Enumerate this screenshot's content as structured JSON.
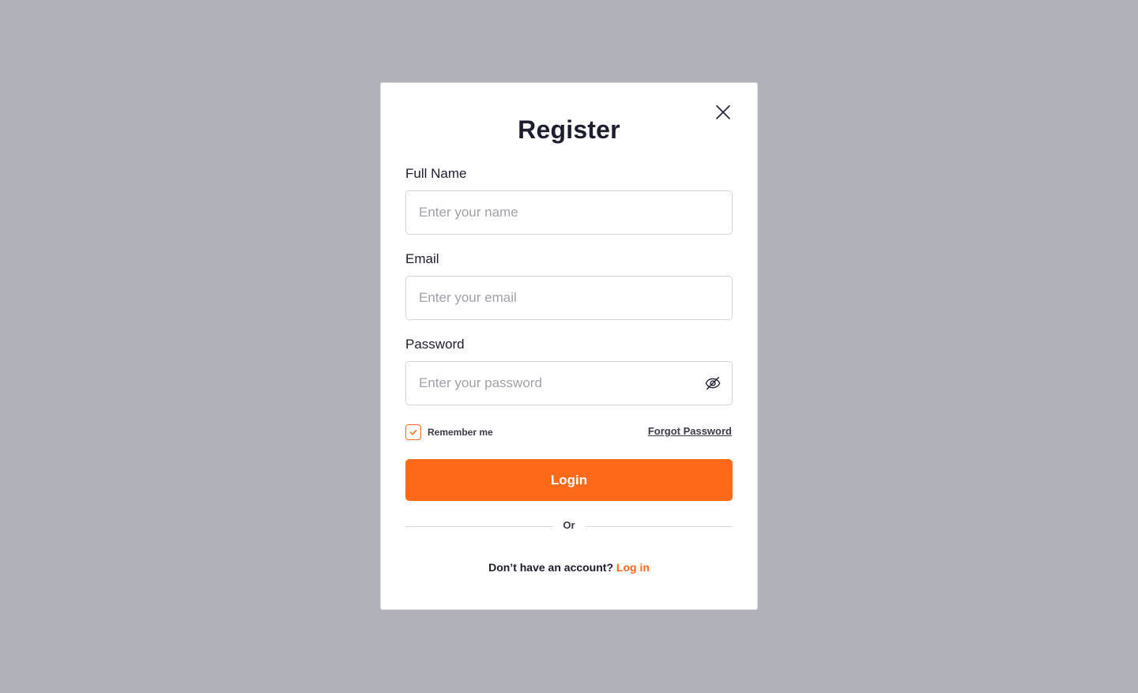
{
  "modal": {
    "title": "Register",
    "fields": {
      "full_name": {
        "label": "Full Name",
        "placeholder": "Enter your name",
        "value": ""
      },
      "email": {
        "label": "Email",
        "placeholder": "Enter your email",
        "value": ""
      },
      "password": {
        "label": "Password",
        "placeholder": "Enter your password",
        "value": ""
      }
    },
    "remember_me": {
      "label": "Remember me",
      "checked": true
    },
    "forgot_password_label": "Forgot Password",
    "submit_label": "Login",
    "divider_label": "Or",
    "footer": {
      "prompt": "Don’t have an account?",
      "link_label": "Log in"
    },
    "icons": {
      "close": "close-icon",
      "password_toggle": "eye-off-icon",
      "checkbox": "check-icon"
    }
  },
  "colors": {
    "accent": "#ff6a1a",
    "overlay": "#b0b1b9",
    "text": "#1c1d2e"
  }
}
